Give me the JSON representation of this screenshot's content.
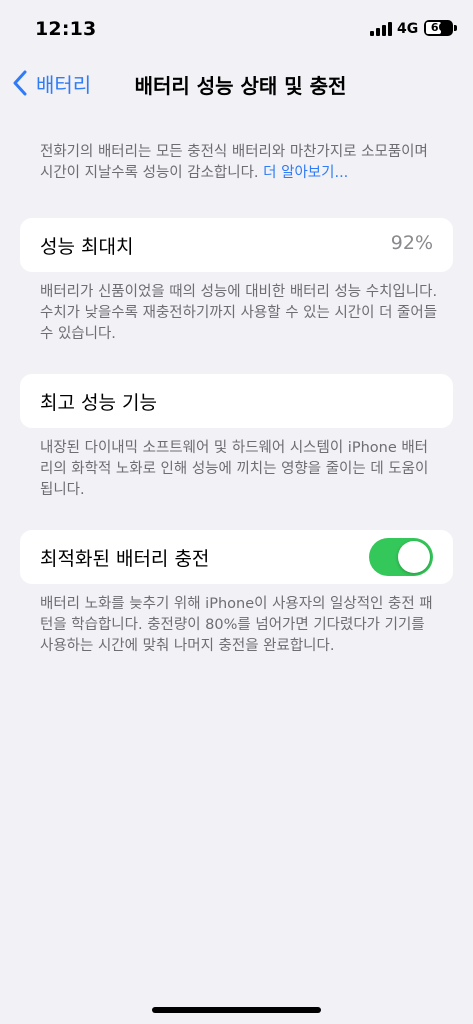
{
  "status_bar": {
    "time": "12:13",
    "network": "4G",
    "battery_level": "60",
    "battery_fraction": 0.6
  },
  "nav": {
    "back_label": "배터리",
    "title": "배터리 성능 상태 및 충전"
  },
  "intro": {
    "text": "전화기의 배터리는 모든 충전식 배터리와 마찬가지로 소모품이며 시간이 지날수록 성능이 감소합니다. ",
    "link": "더 알아보기..."
  },
  "max_capacity": {
    "label": "성능 최대치",
    "value": "92%",
    "footnote": "배터리가 신품이었을 때의 성능에 대비한 배터리 성능 수치입니다. 수치가 낮을수록 재충전하기까지 사용할 수 있는 시간이 더 줄어들 수 있습니다."
  },
  "peak_performance": {
    "label": "최고 성능 기능",
    "footnote": "내장된 다이내믹 소프트웨어 및 하드웨어 시스템이 iPhone 배터리의 화학적 노화로 인해 성능에 끼치는 영향을 줄이는 데 도움이 됩니다."
  },
  "optimized_charging": {
    "label": "최적화된 배터리 충전",
    "enabled": true,
    "footnote": "배터리 노화를 늦추기 위해 iPhone이 사용자의 일상적인 충전 패턴을 학습합니다. 충전량이 80%를 넘어가면 기다렸다가 기기를 사용하는 시간에 맞춰 나머지 충전을 완료합니다."
  },
  "colors": {
    "accent": "#2f7cf6",
    "toggle_on": "#34c759",
    "background": "#f2f1f6",
    "secondary_text": "#6d6d72"
  }
}
